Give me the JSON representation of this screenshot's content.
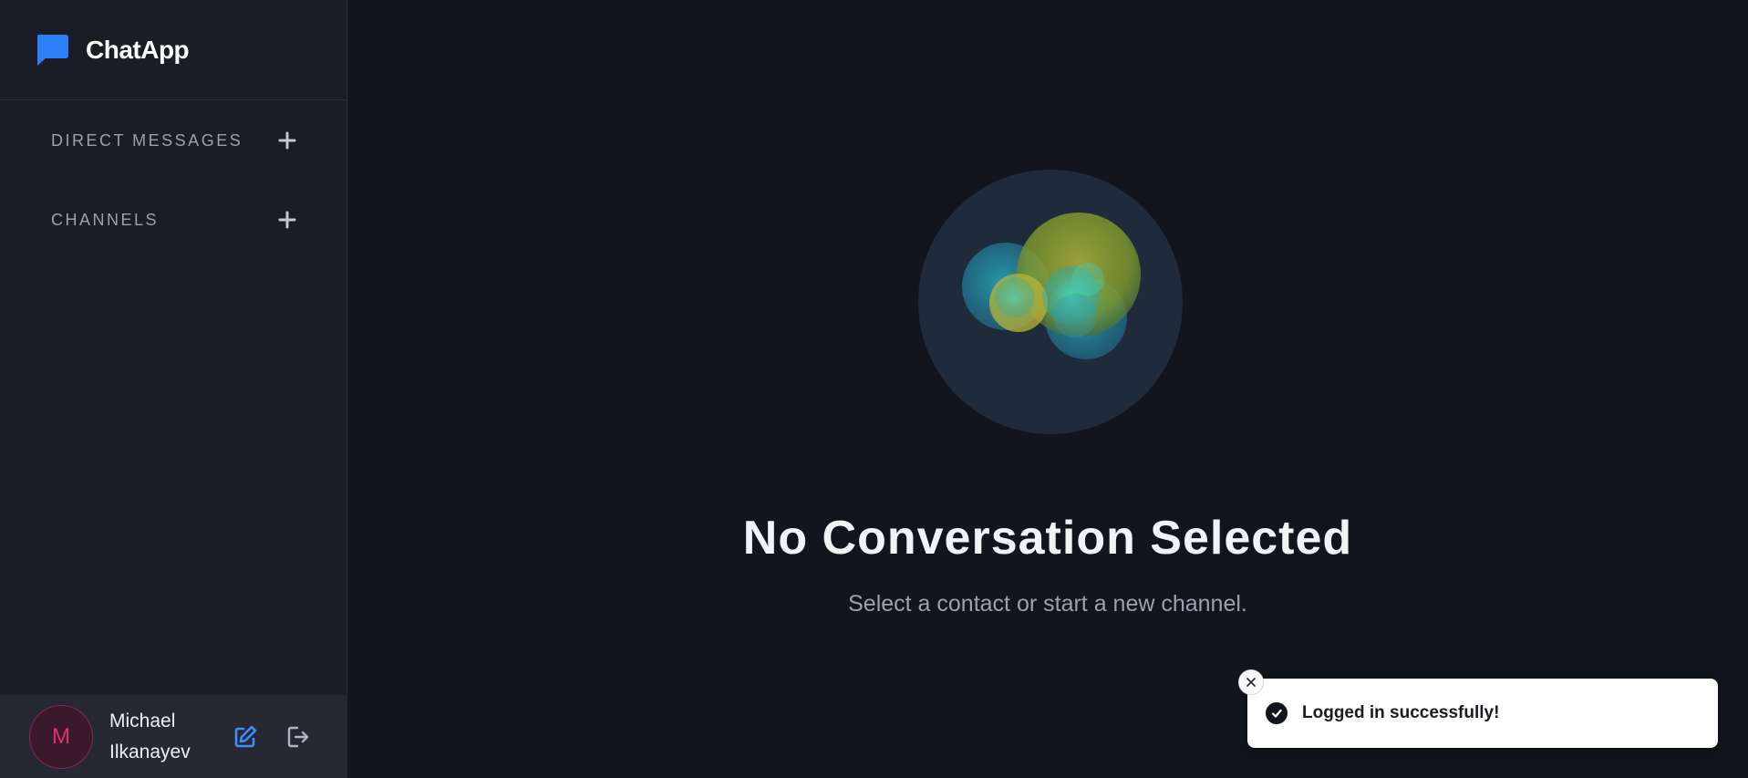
{
  "brand": {
    "name": "ChatApp",
    "icon": "chat-bubble-icon",
    "accent": "#2d7ff9"
  },
  "sidebar": {
    "sections": [
      {
        "label": "DIRECT MESSAGES",
        "icon": "plus-icon"
      },
      {
        "label": "CHANNELS",
        "icon": "plus-icon"
      }
    ]
  },
  "profile": {
    "initial": "M",
    "name_line1": "Michael",
    "name_line2": "Ilkanayev",
    "avatar_color": "#e0306e",
    "edit_icon": "edit-icon",
    "logout_icon": "logout-icon"
  },
  "main": {
    "title": "No Conversation Selected",
    "subtitle": "Select a contact or start a new channel."
  },
  "toast": {
    "message": "Logged in successfully!",
    "status_icon": "check-circle-icon",
    "close_icon": "close-icon"
  }
}
